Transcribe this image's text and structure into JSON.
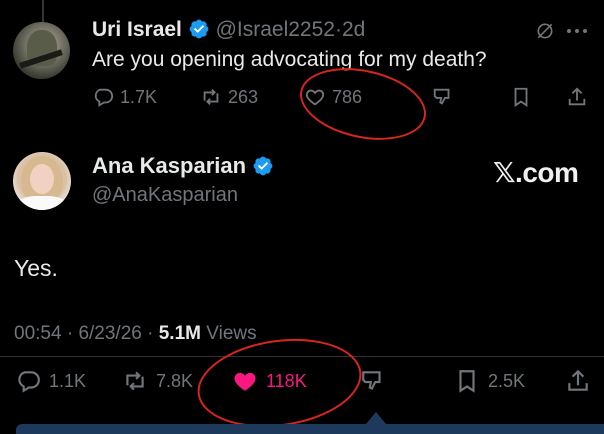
{
  "reply": {
    "display_name": "Uri Israel",
    "handle": "@Israel2252",
    "separator": "·",
    "time": "2d",
    "text": "Are you opening advocating for my death?",
    "stats": {
      "replies": "1.7K",
      "reposts": "263",
      "likes": "786"
    }
  },
  "post": {
    "display_name": "Ana Kasparian",
    "handle": "@AnaKasparian",
    "text": "Yes.",
    "time": "00:54",
    "date": "6/23/26",
    "separator": "·",
    "views_count": "5.1M",
    "views_label": "Views",
    "stats": {
      "replies": "1.1K",
      "reposts": "7.8K",
      "likes": "118K",
      "bookmarks": "2.5K"
    }
  },
  "watermark": "𝕏.com",
  "colors": {
    "background": "#000000",
    "verified": "#1d9bf0",
    "like_active": "#f91880",
    "annotation_circle": "#d7261e",
    "muted_text": "#71767b"
  },
  "icons": [
    "verified-badge-icon",
    "grok-icon",
    "more-icon",
    "reply-icon",
    "repost-icon",
    "like-icon",
    "dislike-icon",
    "bookmark-icon",
    "share-icon"
  ]
}
